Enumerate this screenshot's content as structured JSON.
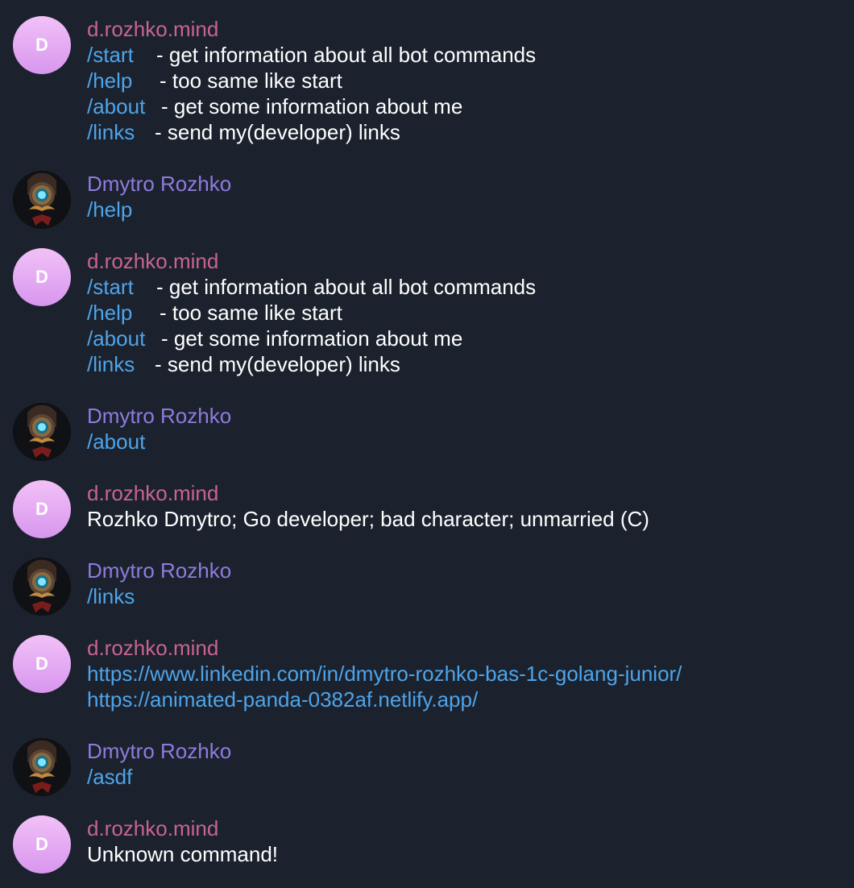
{
  "bot_name": "d.rozhko.mind",
  "user_name": "Dmytro Rozhko",
  "bot_avatar_letter": "D",
  "colors": {
    "background": "#1b222d",
    "bot_name": "#c9648f",
    "user_name": "#8f7bdf",
    "command": "#4ea4ea",
    "text": "#ffffff"
  },
  "help_list": [
    {
      "command": "/start",
      "description": "- get information about all bot commands"
    },
    {
      "command": "/help",
      "description": "- too same like start"
    },
    {
      "command": "/about",
      "description": "- get some information about me"
    },
    {
      "command": "/links",
      "description": "- send my(developer) links"
    }
  ],
  "messages": {
    "m2_command": "/help",
    "m4_command": "/about",
    "m5_text": "Rozhko Dmytro; Go developer; bad character; unmarried (C)",
    "m6_command": "/links",
    "m7_links": [
      "https://www.linkedin.com/in/dmytro-rozhko-bas-1c-golang-junior/",
      "https://animated-panda-0382af.netlify.app/"
    ],
    "m8_command": "/asdf",
    "m9_text": "Unknown command!"
  },
  "icons": {
    "bot_avatar": "letter-avatar",
    "user_avatar": "robot-portrait-avatar"
  }
}
